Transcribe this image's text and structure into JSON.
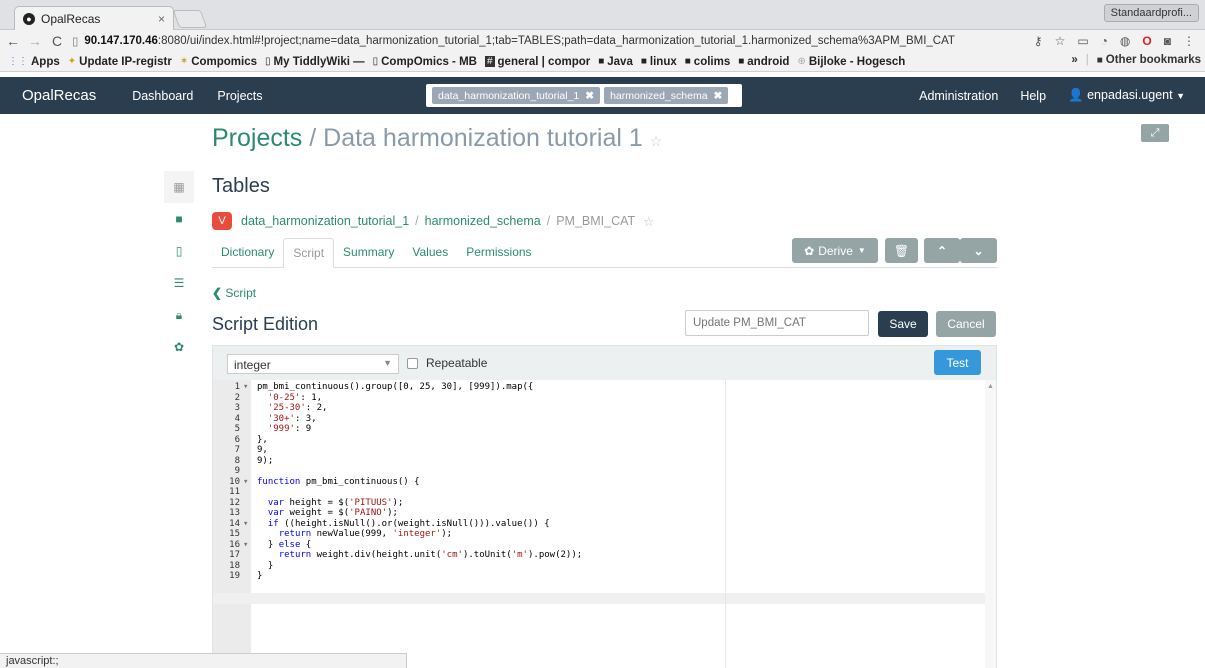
{
  "browser": {
    "tab_title": "OpalRecas",
    "tab_close": "×",
    "profile": "Standaardprofi...",
    "url_host": "90.147.170.46",
    "url_rest": ":8080/ui/index.html#!project;name=data_harmonization_tutorial_1;tab=TABLES;path=data_harmonization_tutorial_1.harmonized_schema%3APM_BMI_CAT",
    "bookmarks": [
      {
        "label": "Apps",
        "icon": "apps-icon"
      },
      {
        "label": "Update IP-registr",
        "icon": "star-icon"
      },
      {
        "label": "Compomics",
        "icon": "compomics-icon"
      },
      {
        "label": "My TiddlyWiki —",
        "icon": "page-icon"
      },
      {
        "label": "CompOmics - MB",
        "icon": "page-icon"
      },
      {
        "label": "general | compor",
        "icon": "slack-icon"
      },
      {
        "label": "Java",
        "icon": "folder-icon"
      },
      {
        "label": "linux",
        "icon": "folder-icon"
      },
      {
        "label": "colims",
        "icon": "folder-icon"
      },
      {
        "label": "android",
        "icon": "folder-icon"
      },
      {
        "label": "Bijloke - Hogesch",
        "icon": "globe-icon"
      }
    ],
    "bookmarks_more": "»",
    "other_bookmarks": "Other bookmarks"
  },
  "navbar": {
    "brand": "OpalRecas",
    "links": [
      "Dashboard",
      "Projects"
    ],
    "tags": [
      "data_harmonization_tutorial_1",
      "harmonized_schema"
    ],
    "right": [
      "Administration",
      "Help",
      "enpadasi.ugent"
    ]
  },
  "page": {
    "projects": "Projects",
    "project_name": "/ Data harmonization tutorial 1",
    "tables_title": "Tables",
    "badge": "V",
    "path": [
      "data_harmonization_tutorial_1",
      "harmonized_schema",
      "PM_BMI_CAT"
    ],
    "tabs": [
      "Dictionary",
      "Script",
      "Summary",
      "Values",
      "Permissions"
    ],
    "active_tab": "Script",
    "derive_label": "Derive",
    "back_label": "Script",
    "edition_title": "Script Edition",
    "update_placeholder": "Update PM_BMI_CAT",
    "save_label": "Save",
    "cancel_label": "Cancel",
    "value_type": "integer",
    "repeatable_label": "Repeatable",
    "test_label": "Test"
  },
  "code_lines": [
    "pm_bmi_continuous().group([0, 25, 30], [999]).map({",
    "  '0-25': 1,",
    "  '25-30': 2,",
    "  '30+': 3,",
    "  '999': 9",
    "},",
    "9,",
    "9);",
    "",
    "function pm_bmi_continuous() {",
    "",
    "  var height = $('PITUUS');",
    "  var weight = $('PAINO');",
    "  if ((height.isNull().or(weight.isNull())).value()) {",
    "    return newValue(999, 'integer');",
    "  } else {",
    "    return weight.div(height.unit('cm').toUnit('m').pow(2));",
    "  }",
    "}"
  ],
  "status_text": "javascript:;",
  "colors": {
    "navbar": "#2b3e50",
    "accent": "#2b8b6e",
    "badge": "#e74c3c",
    "gray_button": "#95a5a6",
    "test_button": "#3498db"
  }
}
